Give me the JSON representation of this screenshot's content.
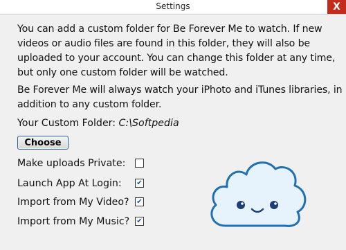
{
  "window": {
    "title": "Settings",
    "close_label": "X"
  },
  "description": {
    "paragraph1": "You can add a custom folder for Be Forever Me to watch. If new videos or audio files are found in this folder, they will also be uploaded to your account. You can change this folder at any time, but only one custom folder will be watched.",
    "paragraph2": "Be Forever Me will always watch your iPhoto and iTunes libraries, in addition to any custom folder."
  },
  "folder": {
    "label": "Your Custom Folder: ",
    "path": "C:\\Softpedia"
  },
  "choose_button": {
    "label": "Choose"
  },
  "options": [
    {
      "label": "Make uploads Private:",
      "checked": false
    },
    {
      "label": "Launch App At Login:",
      "checked": true
    },
    {
      "label": "Import from My Video?",
      "checked": true
    },
    {
      "label": "Import from My Music?",
      "checked": true
    }
  ],
  "mascot_icon": "cloud-face-icon",
  "colors": {
    "close_button": "#c42b1c",
    "cloud_fill": "#e6f3fc",
    "cloud_outline": "#1f6fb5"
  }
}
